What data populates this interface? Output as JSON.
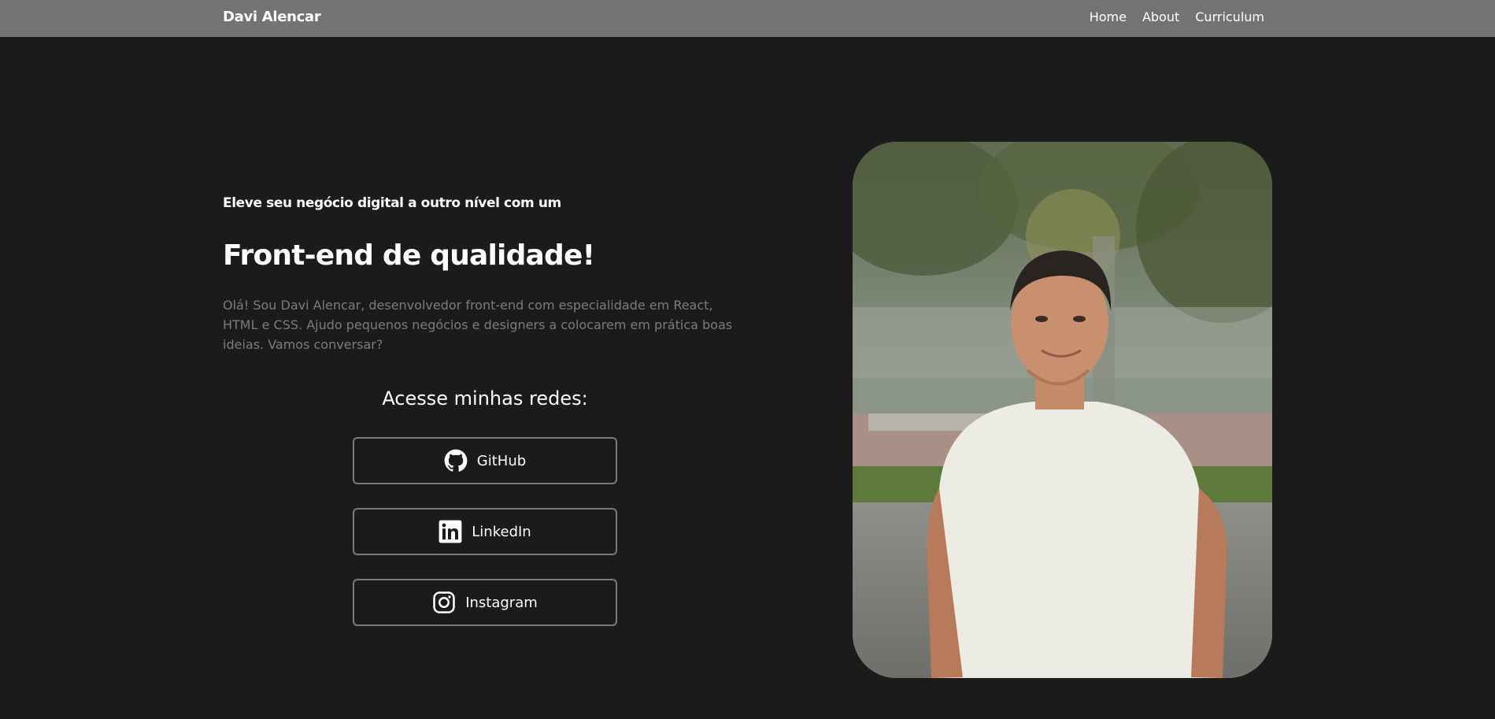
{
  "header": {
    "brand": "Davi Alencar",
    "nav": [
      {
        "label": "Home"
      },
      {
        "label": "About"
      },
      {
        "label": "Curriculum"
      }
    ]
  },
  "hero": {
    "kicker": "Eleve seu negócio digital a outro nível com um",
    "headline": "Front-end de qualidade!",
    "intro": "Olá! Sou Davi Alencar, desenvolvedor front-end com especialidade em React, HTML e CSS. Ajudo pequenos negócios e designers a colocarem em prática boas ideias. Vamos conversar?"
  },
  "social": {
    "title": "Acesse minhas redes:",
    "links": [
      {
        "label": "GitHub",
        "icon": "github-icon"
      },
      {
        "label": "LinkedIn",
        "icon": "linkedin-icon"
      },
      {
        "label": "Instagram",
        "icon": "instagram-icon"
      }
    ]
  },
  "colors": {
    "background": "#1b1b1b",
    "header": "#737373",
    "text": "#ffffff",
    "muted_text": "#7c7c7c",
    "button_border": "#7a7a7a"
  }
}
